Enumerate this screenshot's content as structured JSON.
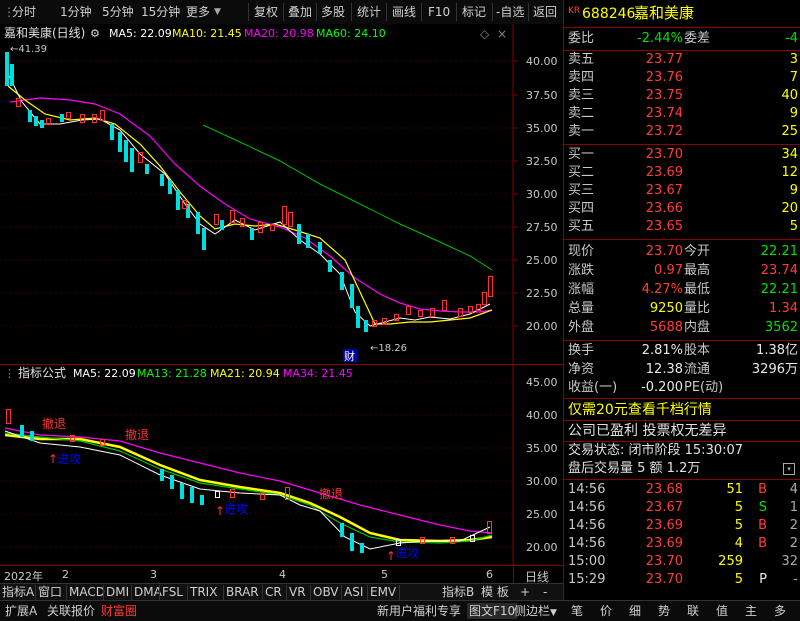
{
  "toolbar": {
    "left": [
      "分时",
      "1分钟",
      "5分钟",
      "15分钟",
      "更多"
    ],
    "right": [
      "复权",
      "叠加",
      "多股",
      "统计",
      "画线",
      "F10",
      "标记",
      "-自选",
      "返回"
    ]
  },
  "stock": {
    "market_badge": "KR",
    "code": "688246",
    "name": "嘉和美康"
  },
  "main_chart": {
    "title": "嘉和美康(日线)",
    "ma": [
      {
        "label": "MA5: 22.09",
        "color": "#ffffff"
      },
      {
        "label": "MA10: 21.45",
        "color": "#ffff00"
      },
      {
        "label": "MA20: 20.98",
        "color": "#ff00ff"
      },
      {
        "label": "MA60: 24.10",
        "color": "#00ff00"
      }
    ],
    "y_ticks": [
      "40.00",
      "37.50",
      "35.00",
      "32.50",
      "30.00",
      "27.50",
      "25.00",
      "22.50",
      "20.00"
    ],
    "high_marker": "41.39",
    "low_marker": "18.26",
    "event_label": "财"
  },
  "ind_chart": {
    "title": "指标公式",
    "ma": [
      {
        "label": "MA5: 22.09",
        "color": "#ffffff"
      },
      {
        "label": "MA13: 21.28",
        "color": "#00ff00"
      },
      {
        "label": "MA21: 20.94",
        "color": "#ffff00"
      },
      {
        "label": "MA34: 21.45",
        "color": "#ff00ff"
      }
    ],
    "y_ticks": [
      "45.00",
      "40.00",
      "35.00",
      "30.00",
      "25.00",
      "20.00"
    ],
    "sell_label": "撤退",
    "buy_label": "进攻"
  },
  "x_axis": {
    "labels": [
      "2022年",
      "2",
      "3",
      "4",
      "5",
      "6"
    ],
    "period": "日线"
  },
  "indicator_tabs": [
    "指标A",
    "窗口",
    "MACD",
    "DMI",
    "DMA",
    "FSL",
    "TRIX",
    "BRAR",
    "CR",
    "VR",
    "OBV",
    "ASI",
    "EMV"
  ],
  "indicator_tabs_right": [
    "指标B",
    "模 板",
    "+",
    "-"
  ],
  "bottom_tabs": [
    "扩展A",
    "关联报价",
    "财富圈"
  ],
  "bottom_right": [
    "新用户福利专享",
    "图文F10",
    "侧边栏"
  ],
  "side_tabs": [
    "笔",
    "价",
    "细",
    "势",
    "联",
    "值",
    "主",
    "多"
  ],
  "quote": {
    "webi": {
      "label": "委比",
      "value": "-2.44%",
      "label2": "委差",
      "value2": "-4"
    },
    "asks": [
      {
        "label": "卖五",
        "price": "23.77",
        "vol": "3"
      },
      {
        "label": "卖四",
        "price": "23.76",
        "vol": "7"
      },
      {
        "label": "卖三",
        "price": "23.75",
        "vol": "40"
      },
      {
        "label": "卖二",
        "price": "23.74",
        "vol": "9"
      },
      {
        "label": "卖一",
        "price": "23.72",
        "vol": "25"
      }
    ],
    "bids": [
      {
        "label": "买一",
        "price": "23.70",
        "vol": "34"
      },
      {
        "label": "买二",
        "price": "23.69",
        "vol": "12"
      },
      {
        "label": "买三",
        "price": "23.67",
        "vol": "9"
      },
      {
        "label": "买四",
        "price": "23.66",
        "vol": "20"
      },
      {
        "label": "买五",
        "price": "23.65",
        "vol": "5"
      }
    ],
    "stats": [
      {
        "l1": "现价",
        "v1": "23.70",
        "c1": "red",
        "l2": "今开",
        "v2": "22.21",
        "c2": "green"
      },
      {
        "l1": "涨跌",
        "v1": "0.97",
        "c1": "red",
        "l2": "最高",
        "v2": "23.74",
        "c2": "red"
      },
      {
        "l1": "涨幅",
        "v1": "4.27%",
        "c1": "red",
        "l2": "最低",
        "v2": "22.21",
        "c2": "green"
      },
      {
        "l1": "总量",
        "v1": "9250",
        "c1": "yellow",
        "l2": "量比",
        "v2": "1.34",
        "c2": "red"
      },
      {
        "l1": "外盘",
        "v1": "5688",
        "c1": "red",
        "l2": "内盘",
        "v2": "3562",
        "c2": "green"
      }
    ],
    "stats2": [
      {
        "l1": "换手",
        "v1": "2.81%",
        "l2": "股本",
        "v2": "1.38亿"
      },
      {
        "l1": "净资",
        "v1": "12.38",
        "l2": "流通",
        "v2": "3296万"
      },
      {
        "l1": "收益(一)",
        "v1": "-0.200",
        "l2": "PE(动)",
        "v2": ""
      }
    ],
    "promo": "仅需20元查看千档行情",
    "notice": "公司已盈利 投票权无差异",
    "status_label": "交易状态: 闭市阶段 15:30:07",
    "after_hours": "盘后交易量 5 额 1.2万",
    "ticks": [
      {
        "time": "14:56",
        "price": "23.68",
        "vol": "51",
        "bs": "B",
        "bsc": "red",
        "n": "4"
      },
      {
        "time": "14:56",
        "price": "23.67",
        "vol": "5",
        "bs": "S",
        "bsc": "green",
        "n": "1"
      },
      {
        "time": "14:56",
        "price": "23.69",
        "vol": "5",
        "bs": "B",
        "bsc": "red",
        "n": "2"
      },
      {
        "time": "14:56",
        "price": "23.69",
        "vol": "4",
        "bs": "B",
        "bsc": "red",
        "n": "2"
      },
      {
        "time": "15:00",
        "price": "23.70",
        "vol": "259",
        "bs": "",
        "bsc": "red",
        "n": "32"
      },
      {
        "time": "15:29",
        "price": "23.70",
        "vol": "5",
        "bs": "P",
        "bsc": "white",
        "n": "-"
      }
    ]
  }
}
